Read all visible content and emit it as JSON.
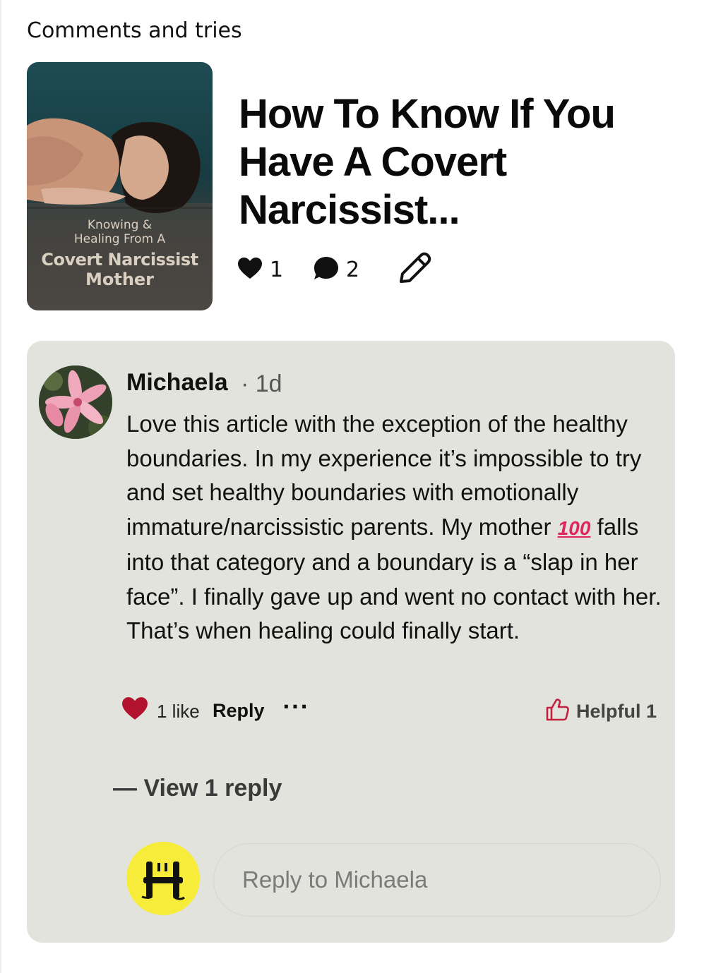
{
  "section": {
    "title": "Comments and tries"
  },
  "pin": {
    "thumbnail": {
      "line1": "Knowing &",
      "line2": "Healing From A",
      "line3": "Covert Narcissist",
      "line4": "Mother"
    },
    "title": "How To Know If You Have A Covert Narcissist...",
    "likes": "1",
    "comments": "2"
  },
  "comment": {
    "author": "Michaela",
    "time": "· 1d",
    "text_before_emoji": "Love this article with the exception of the healthy boundaries. In my experience it’s impossible to try and set healthy boundaries with emotionally immature/narcissistic parents. My mother ",
    "emoji": "100",
    "text_after_emoji": " falls into that category and a boundary is a “slap in her face”. I finally gave up and went no contact with her. That’s when healing could finally start.",
    "like_count": "1 like",
    "reply_label": "Reply",
    "more_label": "···",
    "helpful_label": "Helpful 1",
    "view_replies": "— View 1 reply"
  },
  "reply_box": {
    "placeholder": "Reply to Michaela"
  },
  "colors": {
    "card_bg": "#e3e3dd",
    "heart_red": "#b3122e",
    "avatar_yellow": "#f7ec3a"
  }
}
